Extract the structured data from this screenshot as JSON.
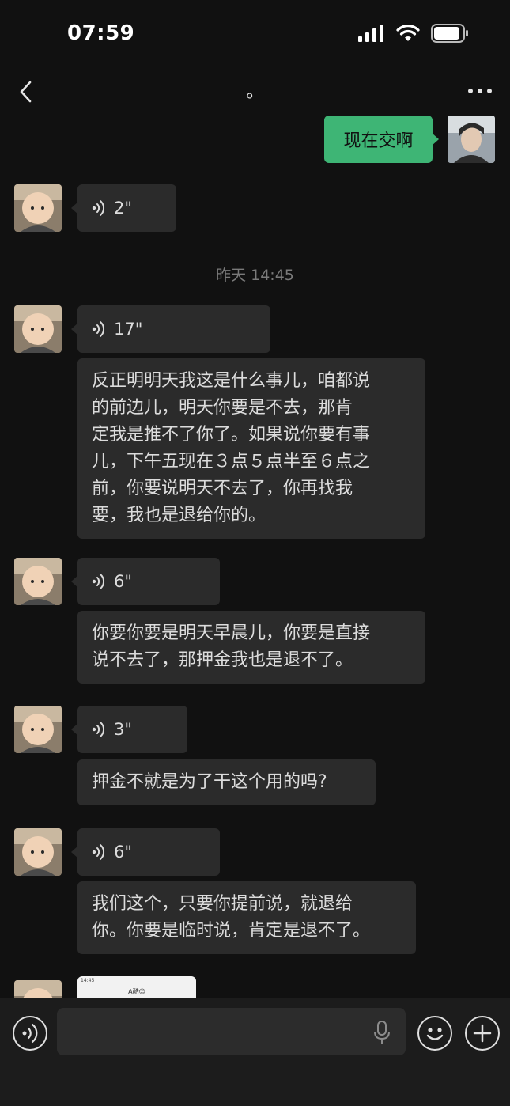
{
  "status": {
    "time": "07:59"
  },
  "header": {
    "title": "。"
  },
  "messages": {
    "sent_text": "现在交啊",
    "voice1": "2\"",
    "timestamp": "昨天 14:45",
    "voice2": "17\"",
    "text2_l1": "反正明明天我这是什么事儿，咱都说",
    "text2_l2": "的前边儿，明天你要是不去，那肯",
    "text2_l3": "定我是推不了你了。如果说你要有事",
    "text2_l4": "儿，下午五现在３点５点半至６点之",
    "text2_l5": "前，你要说明天不去了，你再找我",
    "text2_l6": "要，我也是退给你的。",
    "voice3": "6\"",
    "text3_l1": "你要你要是明天早晨儿，你要是直接",
    "text3_l2": "说不去了，那押金我也是退不了。",
    "voice4": "3\"",
    "text4_l1": "押金不就是为了干这个用的吗?",
    "voice5": "6\"",
    "text5_l1": "我们这个，只要你提前说，就退给",
    "text5_l2": "你。你要是临时说，肯定是退不了。",
    "image_thumb": {
      "time": "14:45",
      "title": "A酷😊"
    }
  },
  "colors": {
    "sent_bubble": "#3eb575",
    "received_bubble": "#2b2b2b",
    "background": "#111111"
  }
}
